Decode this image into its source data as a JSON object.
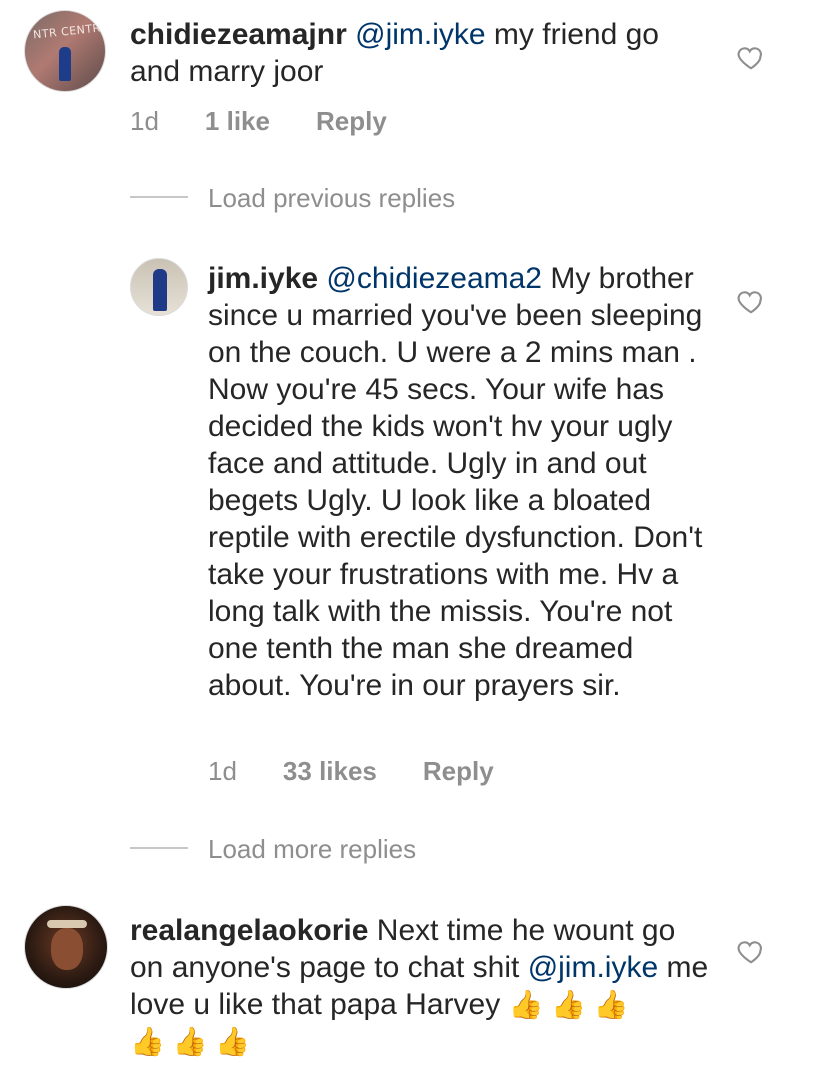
{
  "comments": [
    {
      "username": "chidiezeamajnr",
      "mention": "@jim.iyke",
      "text": " my friend go and marry joor",
      "time": "1d",
      "likes": "1 like",
      "reply": "Reply",
      "avatar_sign": "NTR CENTR"
    },
    {
      "username": "jim.iyke",
      "mention": "@chidiezeama2",
      "text": " My brother since u married you've been sleeping on the couch. U were a 2 mins man . Now you're 45 secs. Your wife has decided the kids won't hv your ugly face and attitude. Ugly in and out begets Ugly. U look like a bloated reptile with erectile dysfunction. Don't take your frustrations with me. Hv a long talk with the missis. You're not one tenth the man she dreamed about. You're in our prayers sir.",
      "time": "1d",
      "likes": "33 likes",
      "reply": "Reply"
    },
    {
      "username": "realangelaokorie",
      "text_before": " Next time he wount go on anyone's page to chat shit ",
      "mention": "@jim.iyke",
      "text_after": " me love u like that papa Harvey ",
      "emojis_line1": "👍 👍 👍",
      "emojis_line2": "👍 👍 👍"
    }
  ],
  "load_previous": "Load previous replies",
  "load_more": "Load more replies",
  "icons": {
    "like": "heart-outline-icon"
  }
}
